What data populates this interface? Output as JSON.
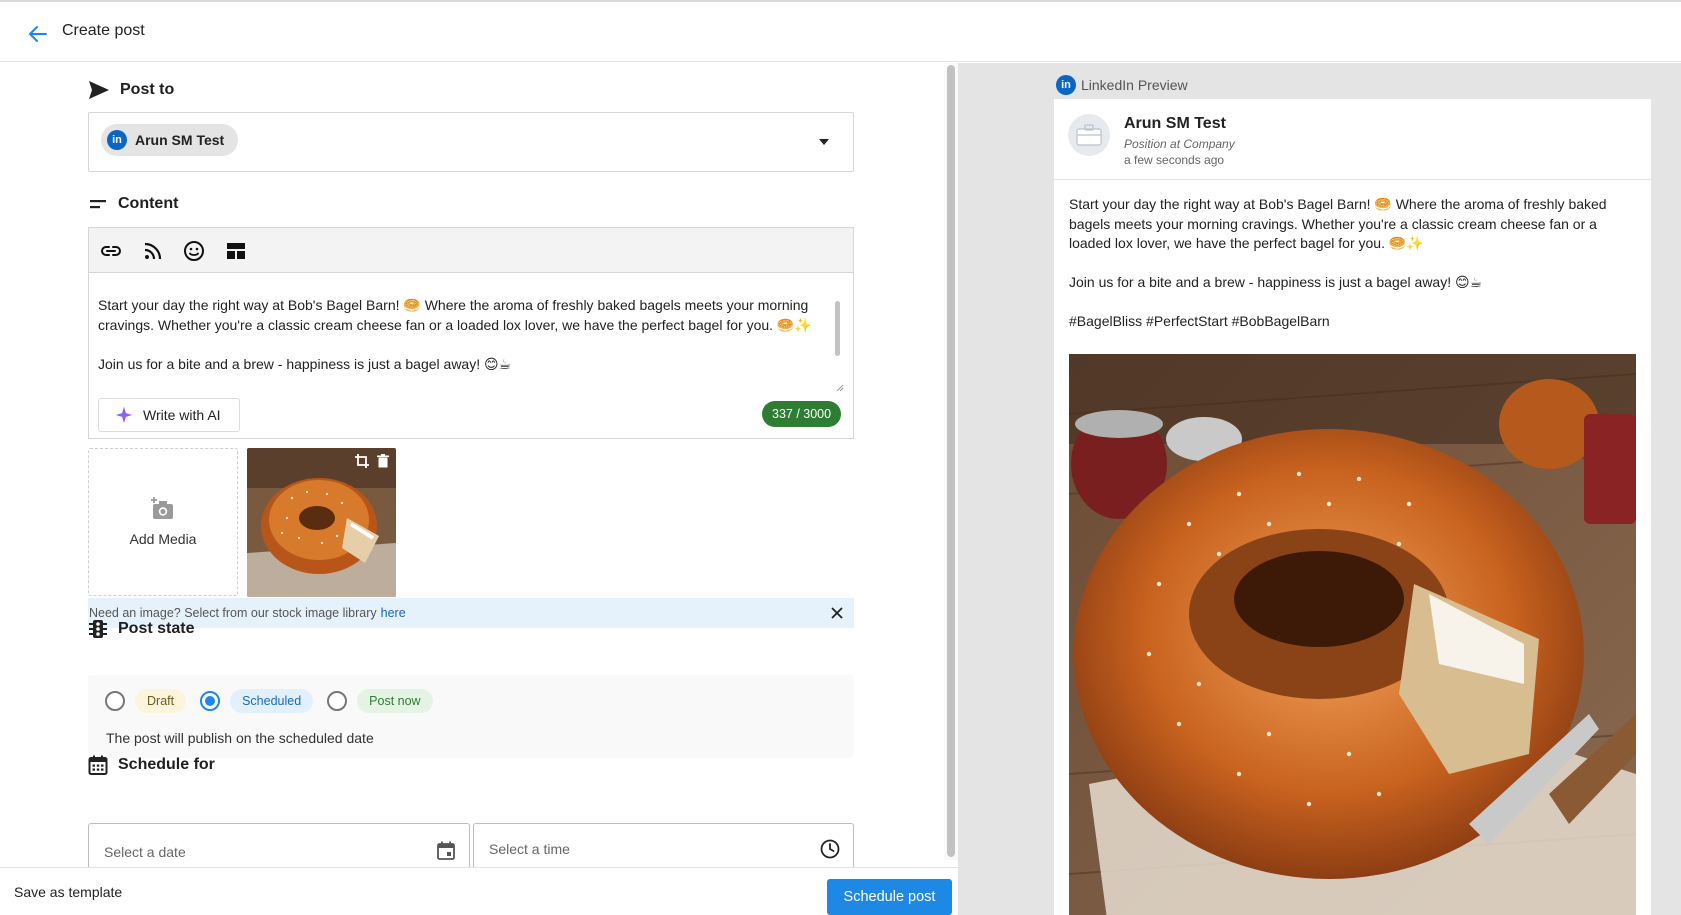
{
  "header": {
    "title": "Create post"
  },
  "post_to": {
    "label": "Post to",
    "selected_account": "Arun SM Test",
    "network_badge": "in"
  },
  "content": {
    "label": "Content",
    "toolbar_icons": [
      "link-icon",
      "rss-icon",
      "emoji-icon",
      "layout-icon"
    ],
    "text": "Start your day the right way at Bob's Bagel Barn! 🥯 Where the aroma of freshly baked bagels meets your morning cravings. Whether you're a classic cream cheese fan or a loaded lox lover, we have the perfect bagel for you. 🥯✨\n\nJoin us for a bite and a brew - happiness is just a bagel away! 😊☕",
    "write_ai_label": "Write with AI",
    "char_count": "337 / 3000"
  },
  "media": {
    "add_label": "Add Media",
    "stock_text": "Need an image? Select from our stock image library",
    "stock_link": "here"
  },
  "post_state": {
    "label": "Post state",
    "options": [
      "Draft",
      "Scheduled",
      "Post now"
    ],
    "selected": "Scheduled",
    "note": "The post will publish on the scheduled date"
  },
  "schedule": {
    "label": "Schedule for",
    "date_placeholder": "Select a date",
    "time_placeholder": "Select a time"
  },
  "footer": {
    "save_template": "Save as template",
    "schedule_button": "Schedule post"
  },
  "preview": {
    "label": "LinkedIn Preview",
    "account_name": "Arun SM Test",
    "position_line": "Position at Company",
    "time_ago": "a few seconds ago",
    "text": "Start your day the right way at Bob's Bagel Barn! 🥯 Where the aroma of freshly baked bagels meets your morning cravings. Whether you're a classic cream cheese fan or a loaded lox lover, we have the perfect bagel for you. 🥯✨\n\nJoin us for a bite and a brew - happiness is just a bagel away! 😊☕\n\n#BagelBliss #PerfectStart #BobBagelBarn"
  },
  "colors": {
    "primary": "#1e88e5",
    "linkedin": "#0a66c2",
    "counter_green": "#2e7d32",
    "preview_bg": "#e4e4e4"
  }
}
